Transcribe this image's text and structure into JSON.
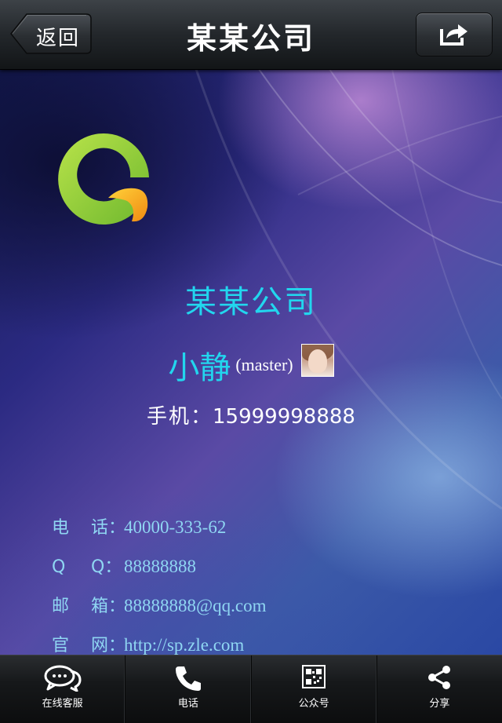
{
  "nav": {
    "back_label": "返回",
    "title": "某某公司",
    "share_icon": "share-icon"
  },
  "card": {
    "company_name": "某某公司",
    "person_name": "小静",
    "person_role": "(master)",
    "mobile_label": "手机：",
    "mobile_value": "15999998888"
  },
  "contacts": [
    {
      "k1": "电",
      "k2": "话：",
      "value": "40000-333-62"
    },
    {
      "k1": "Q",
      "k2": "Q：",
      "value": "88888888"
    },
    {
      "k1": "邮",
      "k2": "箱：",
      "value": "88888888@qq.com"
    },
    {
      "k1": "官",
      "k2": "网：",
      "value": "http://sp.zle.com"
    }
  ],
  "tabs": [
    {
      "label": "在线客服",
      "icon": "chat-icon"
    },
    {
      "label": "电话",
      "icon": "phone-icon"
    },
    {
      "label": "公众号",
      "icon": "qr-code-icon"
    },
    {
      "label": "分享",
      "icon": "share-nodes-icon"
    }
  ],
  "colors": {
    "accent_cyan": "#22d6ee",
    "contact_text": "#8fd6f2",
    "logo_green": "#8cc63f",
    "logo_orange": "#f7a51c"
  }
}
